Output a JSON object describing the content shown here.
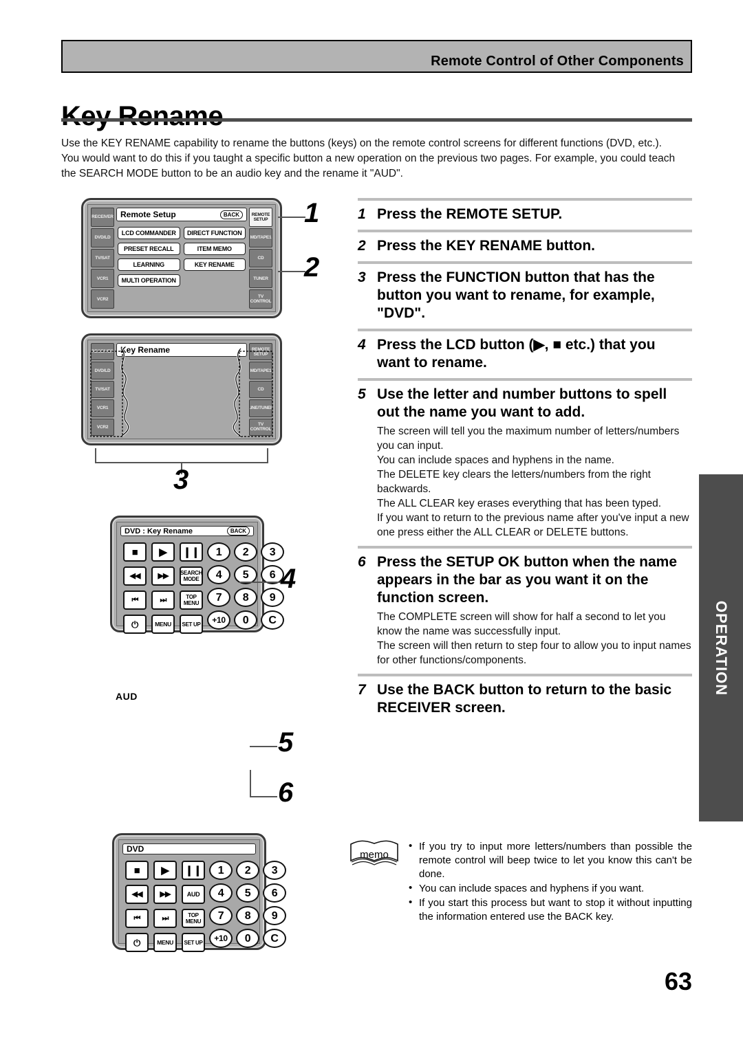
{
  "header": {
    "title": "Remote Control of Other Components"
  },
  "page": {
    "title": "Key Rename",
    "number": "63",
    "side_tab": "OPERATION"
  },
  "intro": "Use the KEY RENAME capability to rename the buttons (keys) on the remote control screens for different functions (DVD, etc.). You would want to do this if you taught a specific button a new operation on the previous two pages. For example, you could teach the SEARCH MODE button to be an audio key and the rename it \"AUD\".",
  "callouts": {
    "one": "1",
    "two": "2",
    "three": "3",
    "four": "4",
    "five": "5",
    "six": "6"
  },
  "aud_label": "AUD",
  "device1": {
    "screen_title": "Remote Setup",
    "back_label": "BACK",
    "left_buttons": [
      "RECEIVER",
      "DVD/LD",
      "TV/SAT",
      "VCR1",
      "VCR2"
    ],
    "right_buttons": [
      "REMOTE SETUP",
      "MD/TAPE1",
      "CD",
      "TUNER",
      "TV CONTROL"
    ],
    "lcd_left": [
      "LCD COMMANDER",
      "PRESET RECALL",
      "LEARNING",
      "MULTI OPERATION"
    ],
    "lcd_right": [
      "DIRECT FUNCTION",
      "ITEM MEMO",
      "KEY RENAME"
    ]
  },
  "device2": {
    "screen_title": "Key Rename",
    "left_buttons": [
      "RECEIVER",
      "DVD/LD",
      "TV/SAT",
      "VCR1",
      "VCR2"
    ],
    "right_buttons": [
      "REMOTE SETUP",
      "MD/TAPE1",
      "CD",
      "LINE/TUNER",
      "TV CONTROL"
    ]
  },
  "device3": {
    "screen_title": "DVD : Key Rename",
    "back_label": "BACK",
    "keys_left": [
      "■",
      "▶",
      "▐▐",
      "◀◀",
      "▶▶",
      "SEARCH MODE",
      "▌◀◀",
      "▶▶▌",
      "TOP MENU",
      "⏻",
      "MENU",
      "SET UP"
    ],
    "keys_right": [
      "1",
      "2",
      "3",
      "4",
      "5",
      "6",
      "7",
      "8",
      "9",
      "+10",
      "0",
      "C"
    ]
  },
  "device4": {
    "screen_title": "DVD",
    "keys_left": [
      "■",
      "▶",
      "▐▐",
      "◀◀",
      "▶▶",
      "AUD",
      "▌◀◀",
      "▶▶▌",
      "TOP MENU",
      "⏻",
      "MENU",
      "SET UP"
    ],
    "keys_right": [
      "1",
      "2",
      "3",
      "4",
      "5",
      "6",
      "7",
      "8",
      "9",
      "+10",
      "0",
      "C"
    ]
  },
  "steps": [
    {
      "num": "1",
      "head": "Press the REMOTE SETUP.",
      "body": ""
    },
    {
      "num": "2",
      "head": "Press the KEY RENAME button.",
      "body": ""
    },
    {
      "num": "3",
      "head": "Press the FUNCTION button that has the button you want to rename, for example, \"DVD\".",
      "body": ""
    },
    {
      "num": "4",
      "head": "Press the LCD button (▶, ■ etc.) that you want to rename.",
      "body": ""
    },
    {
      "num": "5",
      "head": "Use the letter and number buttons to spell out the name you want to add.",
      "body": "The screen will tell you the maximum number of letters/numbers you can input.\nYou can include spaces and hyphens in the name.\nThe DELETE key clears the letters/numbers from the right backwards.\nThe ALL CLEAR key erases everything that has been typed.\nIf you want to return to the previous name after you've input a new one press either the ALL CLEAR or DELETE buttons."
    },
    {
      "num": "6",
      "head": "Press the SETUP OK button when the name appears in the bar as you want it on the function screen.",
      "body": "The COMPLETE screen will show for half a second to let you know the name was successfully input.\nThe screen will then return to step four to allow you to input names for other functions/components."
    },
    {
      "num": "7",
      "head": "Use the BACK button to return to the basic RECEIVER screen.",
      "body": ""
    }
  ],
  "memo": {
    "label": "memo",
    "items": [
      "If you try to input more letters/numbers than possible the remote control will beep twice to let you know this can't be done.",
      "You can include spaces and hyphens if you want.",
      "If you start this process but want to stop it without inputting the information entered use the BACK key."
    ]
  }
}
